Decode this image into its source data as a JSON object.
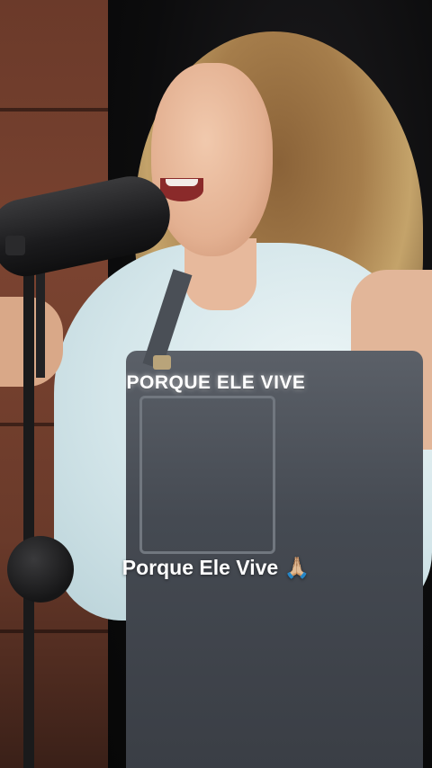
{
  "video": {
    "overlay_title": "PORQUE ELE VIVE",
    "caption": "Porque Ele Vive 🙏🏼"
  },
  "icons": {
    "caption_emoji": "folded-hands-icon"
  },
  "colors": {
    "caption_text": "#ffffff",
    "background": "#0b0b0c"
  }
}
